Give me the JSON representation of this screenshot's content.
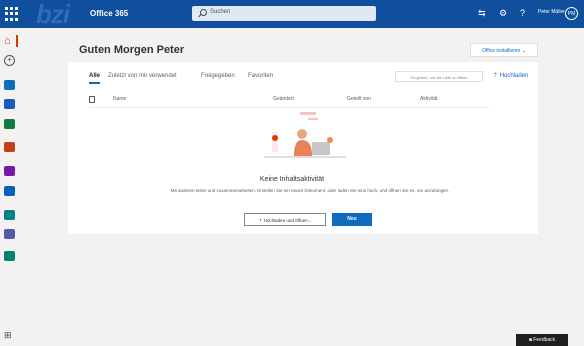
{
  "topbar": {
    "brand_ghost": "bzi",
    "app_name": "Office 365",
    "search_placeholder": "Suchen",
    "user_name": "Peter Müller",
    "avatar_initials": "PM",
    "icons": [
      "app-launcher-icon",
      "teams-icon",
      "settings-icon",
      "help-icon"
    ],
    "help_label": "?"
  },
  "rail": {
    "apps": [
      {
        "name": "outlook",
        "color": "#0f6cbd"
      },
      {
        "name": "word",
        "color": "#185abd"
      },
      {
        "name": "excel",
        "color": "#107c41"
      },
      {
        "name": "powerpoint",
        "color": "#c43e1c"
      },
      {
        "name": "onenote",
        "color": "#7719aa"
      },
      {
        "name": "onedrive",
        "color": "#0364b8"
      },
      {
        "name": "sharepoint",
        "color": "#038387"
      },
      {
        "name": "teams",
        "color": "#5558af"
      },
      {
        "name": "forms",
        "color": "#008272"
      }
    ],
    "add_label": "+",
    "bottom_label": "⊞"
  },
  "main": {
    "greeting": "Guten Morgen Peter",
    "install_button": "Office installieren ⌄",
    "tabs": [
      "Alle",
      "Zuletzt von mir verwendet",
      "Freigegeben",
      "Favoriten"
    ],
    "filter_placeholder": "Eingeben, um die Liste zu filtern",
    "upload_label": "⇡ Hochladen",
    "columns": [
      "Name",
      "Geändert",
      "Geteilt von",
      "Aktivität"
    ],
    "empty_title": "Keine Inhaltsaktivität",
    "empty_text": "Mit anderen teilen und zusammenarbeiten. Erstellen Sie ein neues Dokument, oder laden Sie eins hoch, und öffnen Sie es, um anzufangen.",
    "btn_upload": "⇡ Hochladen und öffnen...",
    "btn_new": "Neu"
  },
  "feedback": "■ Feedback",
  "colors": {
    "topbar": "#0f4f9e",
    "accent": "#0f6cbd",
    "home": "#d83b01"
  }
}
